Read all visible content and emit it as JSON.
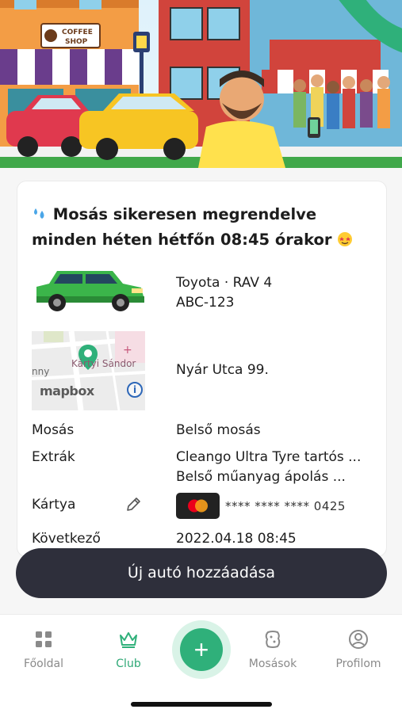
{
  "hero": {
    "shop_sign_line1": "COFFEE",
    "shop_sign_line2": "SHOP"
  },
  "order": {
    "title": "Mosás sikeresen megrendelve minden héten hétfőn 08:45 órakor",
    "car_model": "Toyota · RAV 4",
    "plate": "ABC-123",
    "address": "Nyár Utca 99.",
    "map": {
      "logo_text": "mapbox",
      "place_label": "Kártyi Sándor",
      "left_label": "nny",
      "info_glyph": "i"
    },
    "wash_label": "Mosás",
    "wash_value": "Belső mosás",
    "extras_label": "Extrák",
    "extras": [
      "Cleango Ultra Tyre tartós ...",
      "Belső műanyag ápolás ..."
    ],
    "card_label": "Kártya",
    "card_number": "**** **** **** 0425",
    "next_label": "Következő",
    "next_value": "2022.04.18 08:45"
  },
  "actions": {
    "add_car": "Új autó hozzáadása"
  },
  "nav": {
    "items": [
      {
        "label": "Főoldal",
        "icon": "grid-icon"
      },
      {
        "label": "Club",
        "icon": "crown-icon"
      },
      {
        "label": "Mosások",
        "icon": "sponge-icon"
      },
      {
        "label": "Profilom",
        "icon": "user-icon"
      }
    ],
    "fab_glyph": "+"
  },
  "colors": {
    "accent": "#2fb07a",
    "button_dark": "#2e2f3b",
    "car_green": "#3bb54a",
    "mastercard_red": "#eb001b",
    "mastercard_orange": "#f79e1b"
  }
}
